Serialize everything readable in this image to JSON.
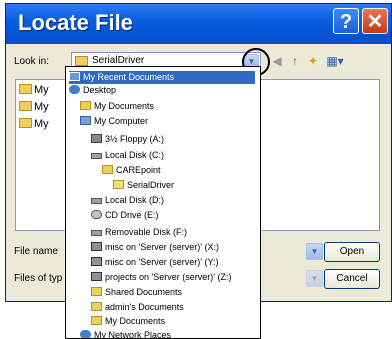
{
  "window": {
    "title": "Locate File"
  },
  "titlebar": {
    "help_glyph": "?",
    "close_glyph": "✕"
  },
  "lookin": {
    "label": "Look in:",
    "value": "SerialDriver"
  },
  "toolbar": {
    "back_glyph": "◀",
    "up_glyph": "↑",
    "newfolder_glyph": "✦",
    "views_glyph": "▦▾"
  },
  "files": [
    "My",
    "My",
    "My"
  ],
  "filename": {
    "label": "File name"
  },
  "filetype": {
    "label": "Files of typ"
  },
  "buttons": {
    "open": "Open",
    "cancel": "Cancel"
  },
  "dropdown": {
    "items": [
      {
        "label": "My Recent Documents",
        "icon": "recent-documents-icon",
        "color": "#4a78c8"
      },
      {
        "label": "Desktop",
        "icon": "desktop-icon",
        "color": "#3f7fcf"
      },
      {
        "label": "My Documents",
        "icon": "folder-icon",
        "color": "#f0cf60"
      },
      {
        "label": "My Computer",
        "icon": "computer-icon",
        "color": "#7aa0d8"
      },
      {
        "label": "3½ Floppy (A:)",
        "icon": "floppy-icon",
        "color": "#888888"
      },
      {
        "label": "Local Disk (C:)",
        "icon": "disk-icon",
        "color": "#a0a0a0"
      },
      {
        "label": "CAREpoint",
        "icon": "folder-icon",
        "color": "#f0cf60"
      },
      {
        "label": "SerialDriver",
        "icon": "folder-open-icon",
        "color": "#f0cf60"
      },
      {
        "label": "Local Disk (D:)",
        "icon": "disk-icon",
        "color": "#a0a0a0"
      },
      {
        "label": "CD Drive (E:)",
        "icon": "cd-drive-icon",
        "color": "#c0c0c0"
      },
      {
        "label": "Removable Disk (F:)",
        "icon": "removable-disk-icon",
        "color": "#a0a0a0"
      },
      {
        "label": "misc on 'Server (server)' (X:)",
        "icon": "network-drive-icon",
        "color": "#909090"
      },
      {
        "label": "misc on 'Server (server)' (Y:)",
        "icon": "network-drive-icon",
        "color": "#909090"
      },
      {
        "label": "projects on 'Server (server)' (Z:)",
        "icon": "network-drive-icon",
        "color": "#909090"
      },
      {
        "label": "Shared Documents",
        "icon": "folder-icon",
        "color": "#f0cf60"
      },
      {
        "label": "admin's Documents",
        "icon": "folder-icon",
        "color": "#f0cf60"
      },
      {
        "label": "My Documents",
        "icon": "folder-icon",
        "color": "#f0cf60"
      },
      {
        "label": "My Network Places",
        "icon": "network-places-icon",
        "color": "#3f7fcf"
      }
    ]
  }
}
